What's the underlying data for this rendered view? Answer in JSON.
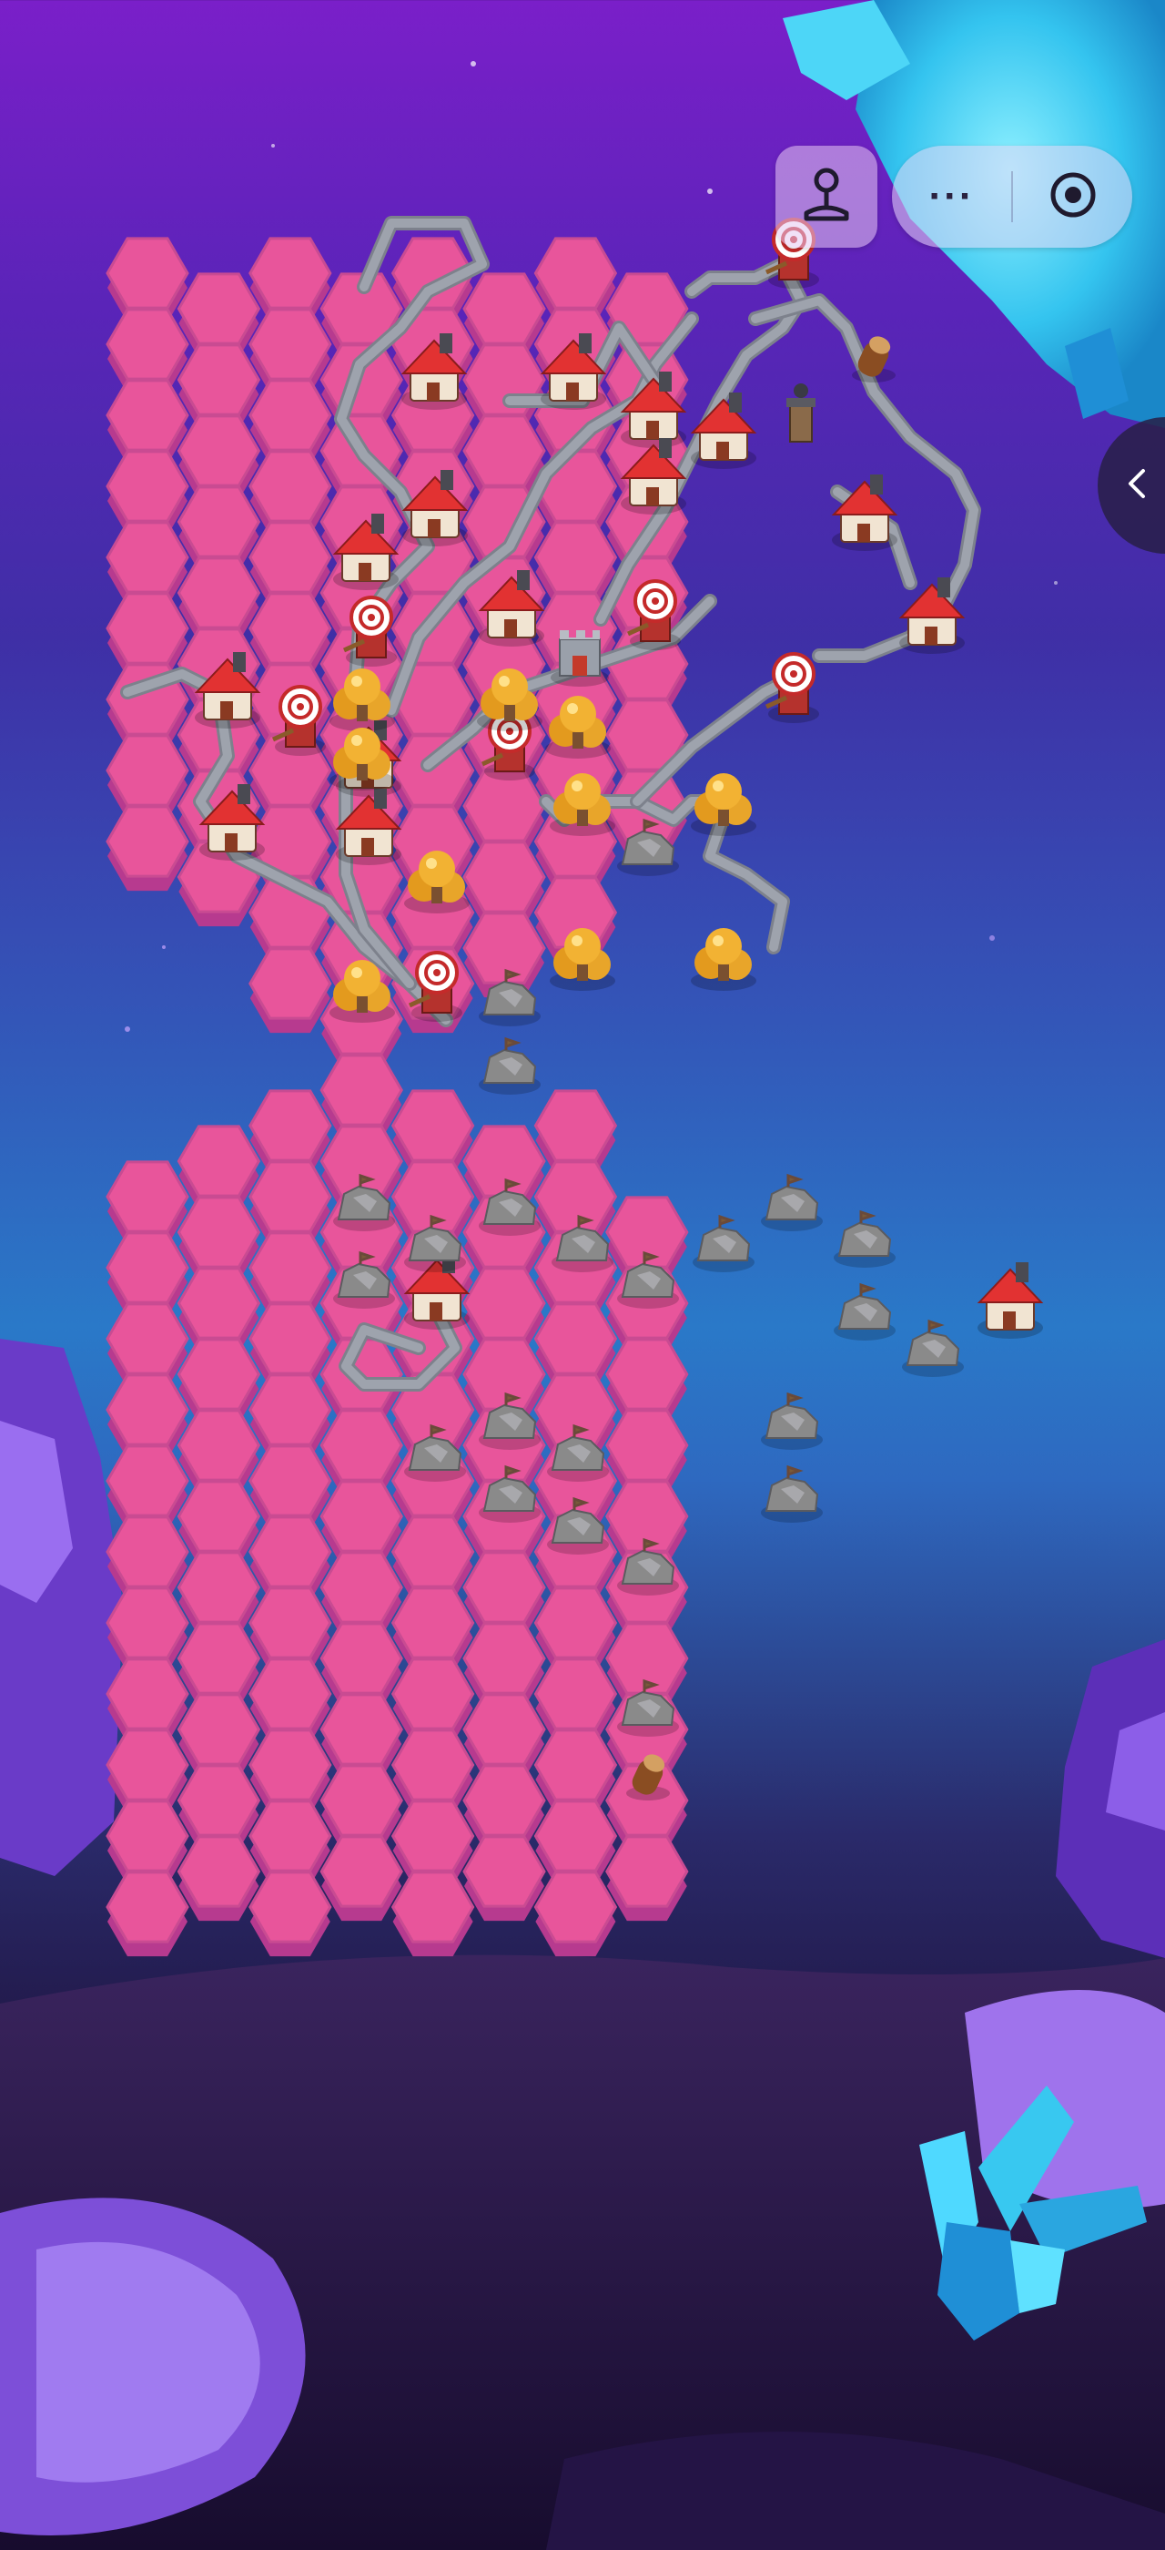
{
  "game": {
    "title": ""
  },
  "menu_capsule": {
    "avatar_button": {
      "icon": "joystick-icon"
    },
    "more_button": {
      "icon": "more-dots-icon",
      "label": "···"
    },
    "close_button": {
      "icon": "record-circle-icon"
    }
  },
  "side_panel_toggle": {
    "icon": "chevron-left-icon"
  },
  "colors": {
    "tile": "#e8559b",
    "tile_side": "#b73a8f",
    "tile_edge": "#c94b92",
    "road": "#9ea3ad",
    "building_roof": "#e23232",
    "gold": "#f2b233",
    "rock": "#8a8a8a",
    "crystal_blue": "#38c8f0",
    "crystal_purple": "#8c4fd6"
  },
  "board": {
    "upper_section": "hex-grid",
    "lower_section": "hex-grid",
    "buildings": [
      {
        "type": "red-house"
      },
      {
        "type": "red-house"
      },
      {
        "type": "red-house"
      },
      {
        "type": "red-house"
      },
      {
        "type": "red-house"
      },
      {
        "type": "red-house"
      },
      {
        "type": "red-house"
      },
      {
        "type": "red-house"
      },
      {
        "type": "red-house"
      },
      {
        "type": "red-house"
      },
      {
        "type": "red-house"
      },
      {
        "type": "red-house"
      },
      {
        "type": "red-house"
      },
      {
        "type": "red-house"
      },
      {
        "type": "red-house"
      },
      {
        "type": "red-house"
      },
      {
        "type": "target-tower"
      },
      {
        "type": "target-tower"
      },
      {
        "type": "target-tower"
      },
      {
        "type": "target-tower"
      },
      {
        "type": "target-tower"
      },
      {
        "type": "target-tower"
      },
      {
        "type": "target-tower"
      },
      {
        "type": "gold-mine"
      },
      {
        "type": "gold-mine"
      },
      {
        "type": "gold-mine"
      },
      {
        "type": "gold-mine"
      },
      {
        "type": "gold-mine"
      },
      {
        "type": "gold-mine"
      },
      {
        "type": "gold-mine"
      },
      {
        "type": "gold-mine"
      },
      {
        "type": "gold-mine"
      },
      {
        "type": "gold-mine"
      },
      {
        "type": "rock-ruin"
      },
      {
        "type": "rock-ruin"
      },
      {
        "type": "rock-ruin"
      },
      {
        "type": "rock-ruin"
      },
      {
        "type": "rock-ruin"
      },
      {
        "type": "rock-ruin"
      },
      {
        "type": "rock-ruin"
      },
      {
        "type": "rock-ruin"
      },
      {
        "type": "rock-ruin"
      },
      {
        "type": "rock-ruin"
      },
      {
        "type": "rock-ruin"
      },
      {
        "type": "rock-ruin"
      },
      {
        "type": "rock-ruin"
      },
      {
        "type": "rock-ruin"
      },
      {
        "type": "rock-ruin"
      },
      {
        "type": "rock-ruin"
      },
      {
        "type": "rock-ruin"
      },
      {
        "type": "rock-ruin"
      },
      {
        "type": "rock-ruin"
      },
      {
        "type": "rock-ruin"
      },
      {
        "type": "rock-ruin"
      },
      {
        "type": "rock-ruin"
      },
      {
        "type": "rock-ruin"
      },
      {
        "type": "lumber-logs"
      },
      {
        "type": "lumber-logs"
      },
      {
        "type": "watch-tower"
      },
      {
        "type": "castle-keep"
      }
    ]
  }
}
